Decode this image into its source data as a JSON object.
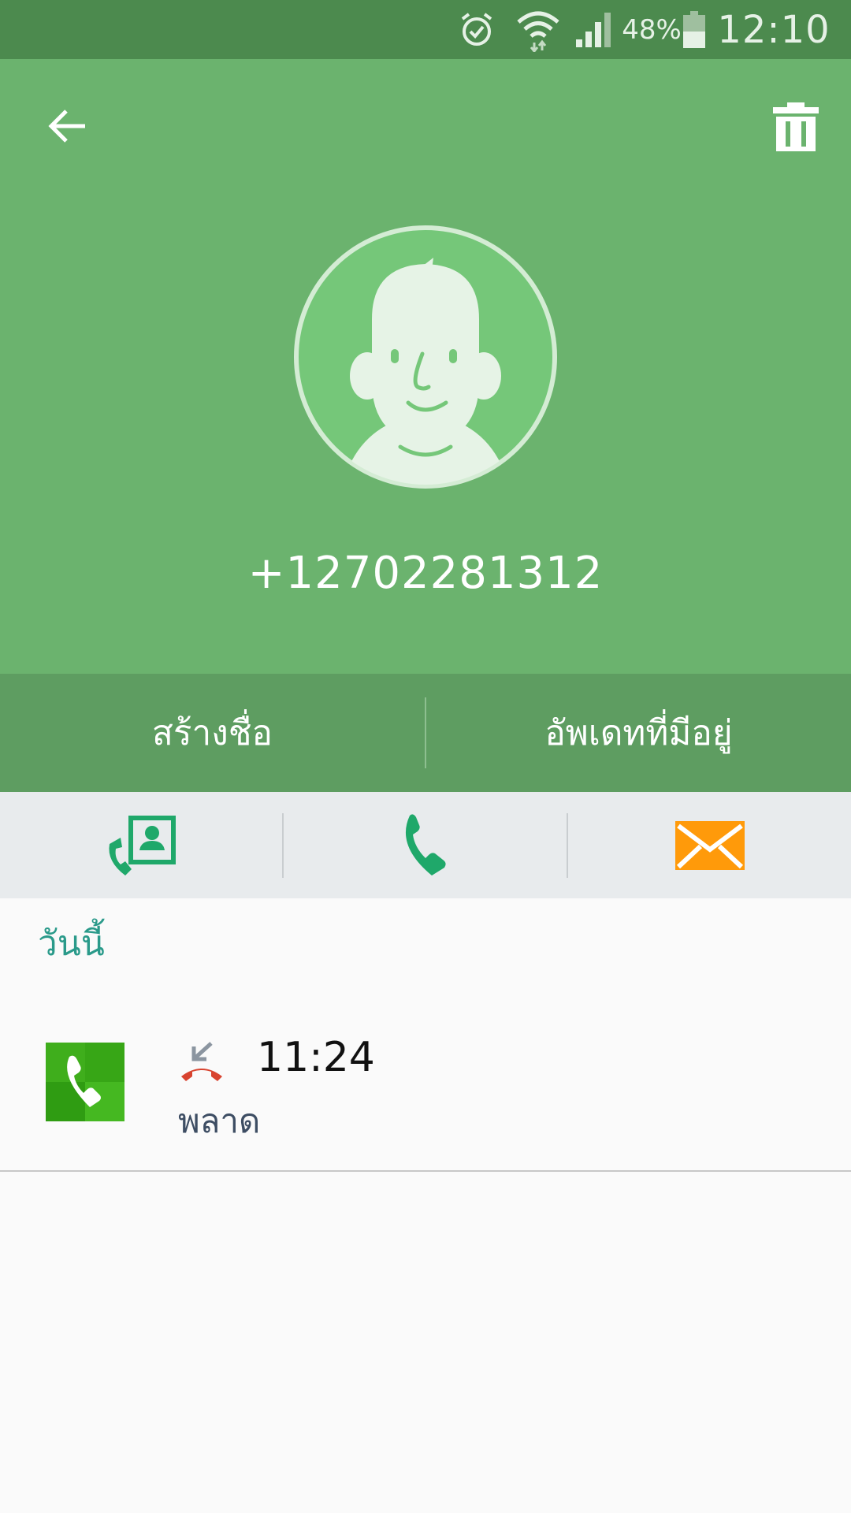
{
  "status_bar": {
    "icons": [
      "alarm-icon",
      "wifi-icon",
      "signal-icon",
      "battery-icon"
    ],
    "battery": "48%",
    "time": "12:10"
  },
  "header": {
    "back_icon": "arrow-left-icon",
    "delete_icon": "trash-icon",
    "avatar_icon": "default-person-icon",
    "phone_number": "+12702281312",
    "bg_color": "#6bb36e"
  },
  "actions": {
    "create_contact": "สร้างชื่อ",
    "update_existing": "อัพเดทที่มีอยู่"
  },
  "quick_actions": [
    {
      "name": "video-call",
      "icon": "contact-call-icon",
      "color": "#1fa86a"
    },
    {
      "name": "voice-call",
      "icon": "phone-icon",
      "color": "#1fa86a"
    },
    {
      "name": "message",
      "icon": "envelope-icon",
      "color": "#ff9a0a"
    }
  ],
  "history": {
    "section_title": "วันนี้",
    "entries": [
      {
        "type_icon": "missed-call-icon",
        "time": "11:24",
        "status": "พลาด",
        "app_icon": "phone-app-icon"
      }
    ]
  }
}
